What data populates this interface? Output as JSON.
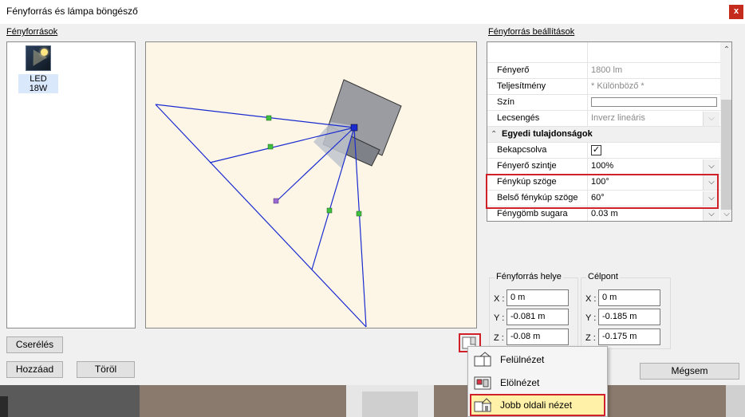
{
  "window": {
    "title": "Fényforrás és lámpa böngésző",
    "close_glyph": "x"
  },
  "library": {
    "section_label": "Fényforrások",
    "items": [
      {
        "label": "LED 18W",
        "icon": "led-lamp-thumbnail"
      }
    ]
  },
  "buttons": {
    "replace": "Cserélés",
    "add": "Hozzáad",
    "delete": "Töröl",
    "cancel": "Mégsem"
  },
  "settings": {
    "section_label": "Fényforrás beállítások",
    "rows": [
      {
        "key": "Fényerő",
        "value": "1800 lm"
      },
      {
        "key": "Teljesítmény",
        "value": "* Különböző *"
      },
      {
        "key": "Szín",
        "value": ""
      },
      {
        "key": "Lecsengés",
        "value": "Inverz lineáris"
      }
    ],
    "group_label": "Egyedi tulajdonságok",
    "group_rows": [
      {
        "key": "Bekapcsolva",
        "value": "✓"
      },
      {
        "key": "Fényerő szintje",
        "value": "100%"
      },
      {
        "key": "Fénykúp szöge",
        "value": "100°"
      },
      {
        "key": "Belső fénykúp szöge",
        "value": "60°"
      },
      {
        "key": "Fénygömb sugara",
        "value": "0.03 m"
      }
    ]
  },
  "position": {
    "title": "Fényforrás helye",
    "x_label": "X :",
    "y_label": "Y :",
    "z_label": "Z :",
    "x": "0 m",
    "y": "-0.081 m",
    "z": "-0.08 m"
  },
  "target": {
    "title": "Célpont",
    "x_label": "X :",
    "y_label": "Y :",
    "z_label": "Z :",
    "x": "0 m",
    "y": "-0.185 m",
    "z": "-0.175 m"
  },
  "view_menu": {
    "items": [
      {
        "label": "Felülnézet",
        "icon": "top-view-icon"
      },
      {
        "label": "Elölnézet",
        "icon": "front-view-icon"
      },
      {
        "label": "Jobb oldali nézet",
        "icon": "right-side-view-icon",
        "active": true
      }
    ]
  },
  "colors": {
    "accent_red": "#d0202a",
    "cone_line": "#1a2bd0",
    "viewport_bg": "#fdf6e6"
  }
}
